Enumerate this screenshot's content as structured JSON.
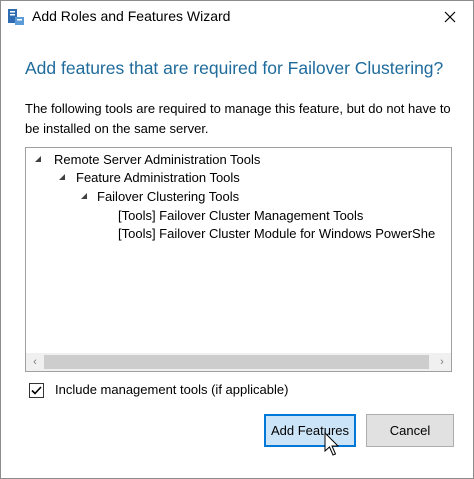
{
  "window": {
    "title": "Add Roles and Features Wizard",
    "icon": "server-manager-icon"
  },
  "dialog": {
    "heading": "Add features that are required for Failover Clustering?",
    "description": "The following tools are required to manage this feature, but do not have to be installed on the same server.",
    "tree": [
      {
        "label": "Remote Server Administration Tools",
        "level": 0,
        "expanded": true
      },
      {
        "label": "Feature Administration Tools",
        "level": 1,
        "expanded": true
      },
      {
        "label": "Failover Clustering Tools",
        "level": 2,
        "expanded": true
      },
      {
        "label": "[Tools] Failover Cluster Management Tools",
        "level": 3
      },
      {
        "label": "[Tools] Failover Cluster Module for Windows PowerShe",
        "level": 3
      }
    ],
    "include_tools": {
      "label": "Include management tools (if applicable)",
      "checked": true
    },
    "buttons": {
      "add": "Add Features",
      "cancel": "Cancel"
    }
  },
  "colors": {
    "heading": "#1e6b9c",
    "accent": "#0078d7"
  }
}
